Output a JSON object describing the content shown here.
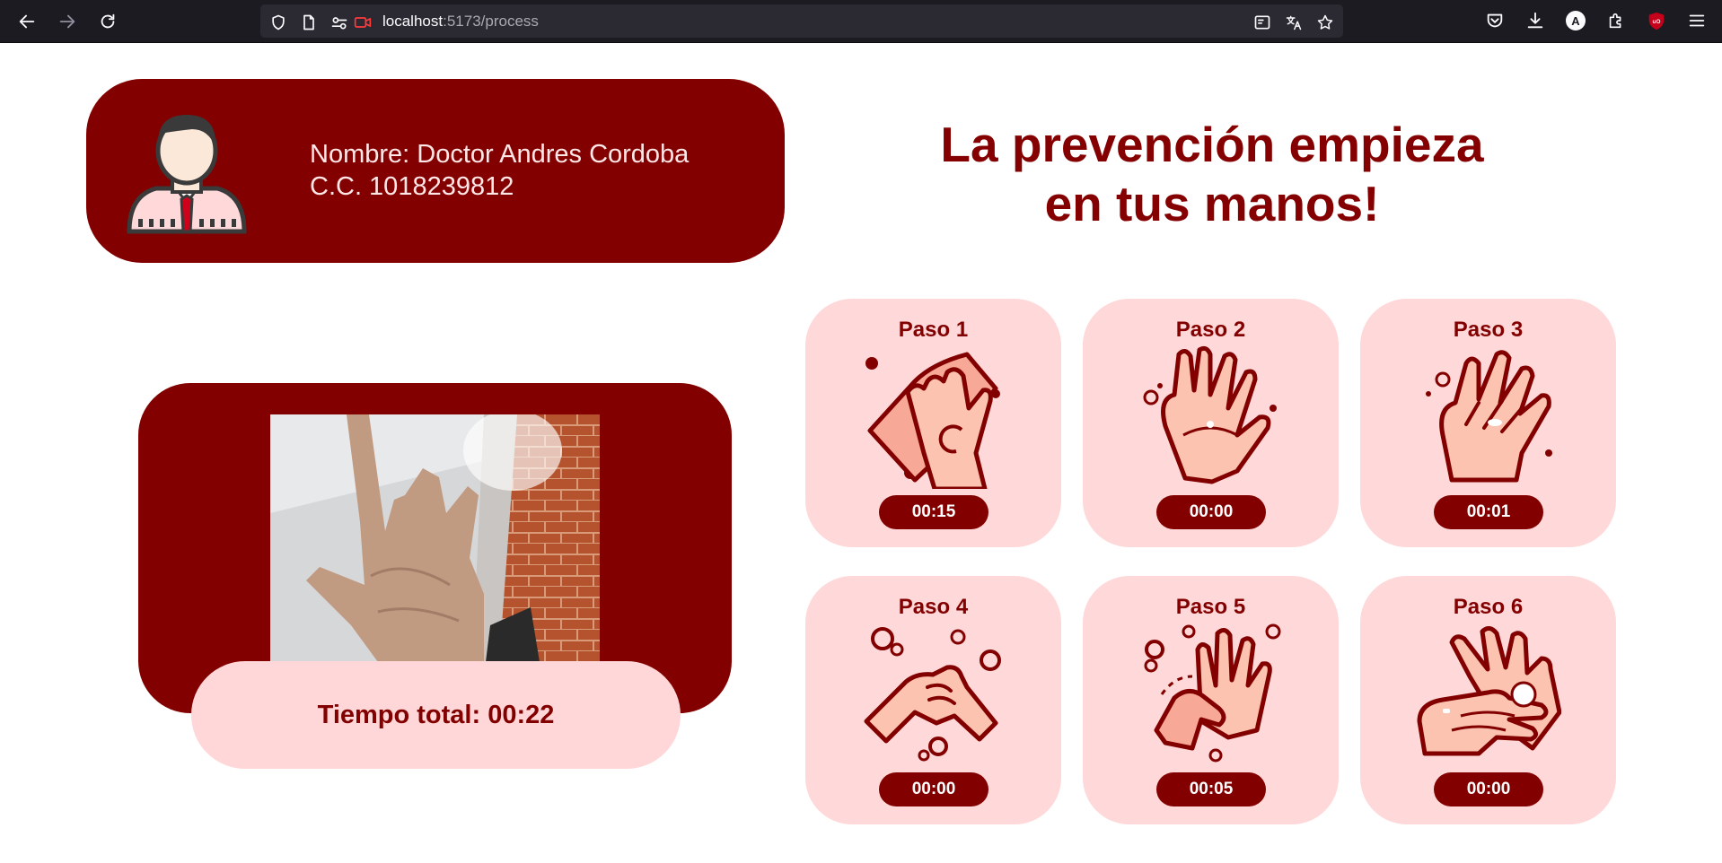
{
  "browser": {
    "url_host": "localhost",
    "url_path": ":5173/process",
    "account_initial": "A"
  },
  "profile": {
    "name_line": "Nombre: Doctor Andres Cordoba",
    "id_line": "C.C. 1018239812"
  },
  "headline": {
    "line1": "La prevención empieza",
    "line2": "en tus manos!"
  },
  "session": {
    "total_time": "Tiempo total: 00:22"
  },
  "steps": [
    {
      "title": "Paso 1",
      "time": "00:15"
    },
    {
      "title": "Paso 2",
      "time": "00:00"
    },
    {
      "title": "Paso 3",
      "time": "00:01"
    },
    {
      "title": "Paso 4",
      "time": "00:00"
    },
    {
      "title": "Paso 5",
      "time": "00:05"
    },
    {
      "title": "Paso 6",
      "time": "00:00"
    }
  ],
  "icons": {
    "back": "back-arrow-icon",
    "forward": "forward-arrow-icon",
    "reload": "reload-icon",
    "shield": "shield-icon",
    "page": "page-icon",
    "permissions": "permissions-icon",
    "camera": "camera-icon",
    "translate": "translate-icon",
    "bookmark": "star-icon",
    "pocket": "pocket-icon",
    "downloads": "download-icon",
    "extensions": "puzzle-icon",
    "ublock": "ublock-icon",
    "menu": "hamburger-menu-icon"
  },
  "colors": {
    "brand_dark_red": "#830000",
    "card_pink": "#ffd8d9",
    "browser_bg": "#1c1b22"
  }
}
